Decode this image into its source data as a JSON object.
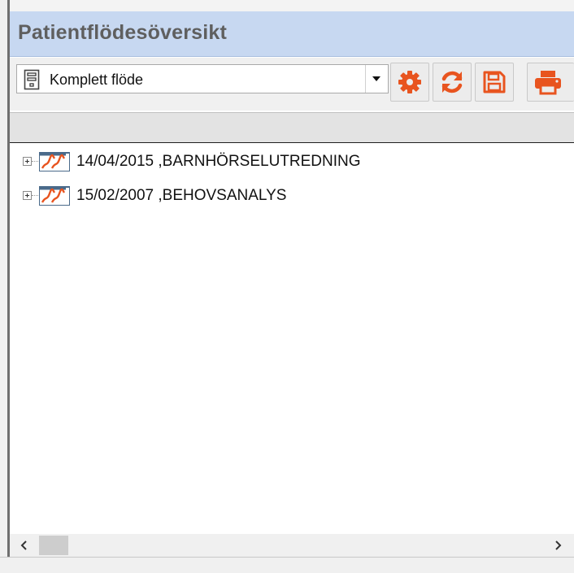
{
  "window": {
    "title": "Patientflödesöversikt"
  },
  "toolbar": {
    "view_select": {
      "value": "Komplett flöde",
      "icon": "document-icon"
    },
    "buttons": [
      {
        "name": "settings",
        "icon": "gear-icon"
      },
      {
        "name": "refresh",
        "icon": "refresh-icon"
      },
      {
        "name": "save",
        "icon": "save-icon"
      },
      {
        "name": "print",
        "icon": "print-icon"
      }
    ],
    "accent_color": "#e8541f"
  },
  "tree": {
    "items": [
      {
        "label": "14/04/2015 ,BARNHÖRSELUTREDNING",
        "icon": "flow-icon",
        "expanded": false
      },
      {
        "label": "15/02/2007 ,BEHOVSANALYS",
        "icon": "flow-icon",
        "expanded": false
      }
    ]
  },
  "colors": {
    "title_bar": "#c7d8f1",
    "icon_orange": "#e8541f"
  }
}
